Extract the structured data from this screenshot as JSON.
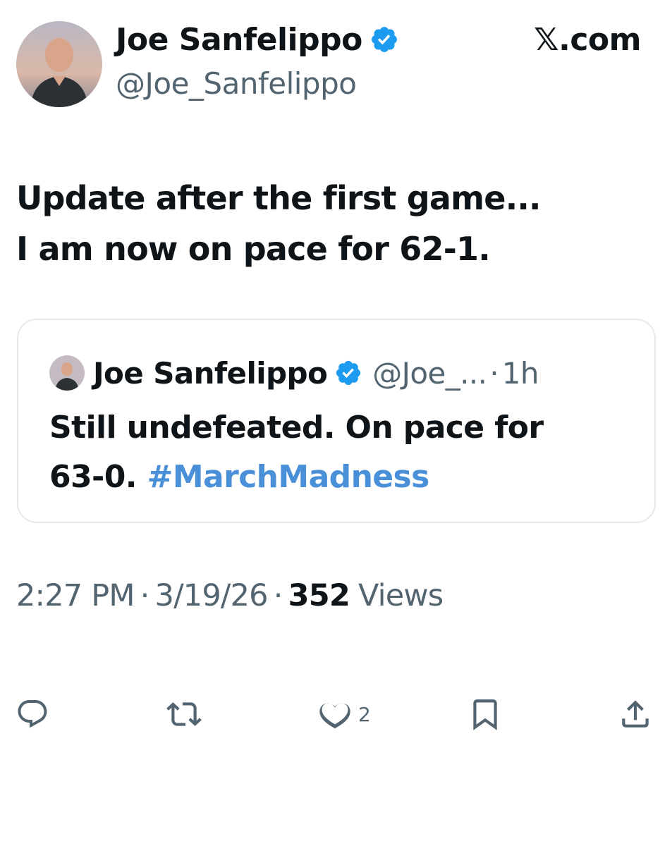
{
  "author": {
    "name": "Joe Sanfelippo",
    "handle": "@Joe_Sanfelippo",
    "verified": true,
    "avatar_icon": "profile-photo-avatar"
  },
  "brand": {
    "label": "𝕏.com"
  },
  "tweet": {
    "lines": [
      "Update after the first game...",
      "I am now on pace for 62-1."
    ]
  },
  "quote": {
    "name": "Joe Sanfelippo",
    "handle": "@Joe_...",
    "separator": "·",
    "time": "1h",
    "verified": true,
    "line1": "Still undefeated. On pace for",
    "line2_text": "63-0. ",
    "line2_hashtag": "#MarchMadness"
  },
  "meta": {
    "time": "2:27 PM",
    "sep1": "·",
    "date": "3/19/26",
    "sep2": "·",
    "views_count": "352",
    "views_label": "Views"
  },
  "actions": {
    "reply_icon": "reply-icon",
    "retweet_icon": "retweet-icon",
    "like_icon": "heart-icon",
    "like_count": "2",
    "bookmark_icon": "bookmark-icon",
    "share_icon": "share-icon"
  },
  "colors": {
    "text": "#0f1419",
    "secondary": "#536471",
    "link": "#4a90d9",
    "verified": "#1d9bf0",
    "border": "#e6e9ec"
  }
}
